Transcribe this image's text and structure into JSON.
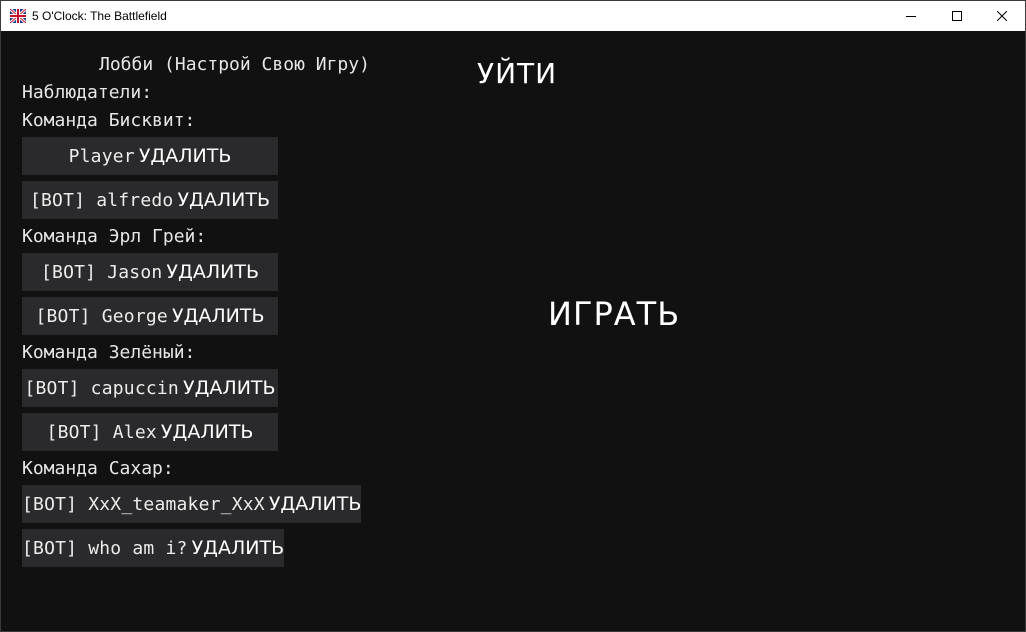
{
  "window": {
    "title": "5 O'Clock: The Battlefield",
    "icon": "uk-flag-icon"
  },
  "lobby": {
    "title": "Лобби (Настрой Свою Игру)",
    "leave_label": "УЙТИ",
    "play_label": "ИГРАТЬ",
    "spectators_label": "Наблюдатели:",
    "remove_label": "УДАЛИТЬ",
    "teams": [
      {
        "label": "Команда Бисквит:",
        "players": [
          "Player",
          "[BOT]  alfredo"
        ]
      },
      {
        "label": "Команда Эрл Грей:",
        "players": [
          "[BOT]  Jason",
          "[BOT]  George"
        ]
      },
      {
        "label": "Команда Зелёный:",
        "players": [
          "[BOT]  capuccin",
          "[BOT]  Alex"
        ]
      },
      {
        "label": "Команда Сахар:",
        "players": [
          "[BOT]  XxX_teamaker_XxX",
          "[BOT]  who am i?"
        ]
      }
    ]
  },
  "colors": {
    "background": "#111111",
    "slot_background": "#2a2a2c",
    "text": "#e6e6e6"
  }
}
